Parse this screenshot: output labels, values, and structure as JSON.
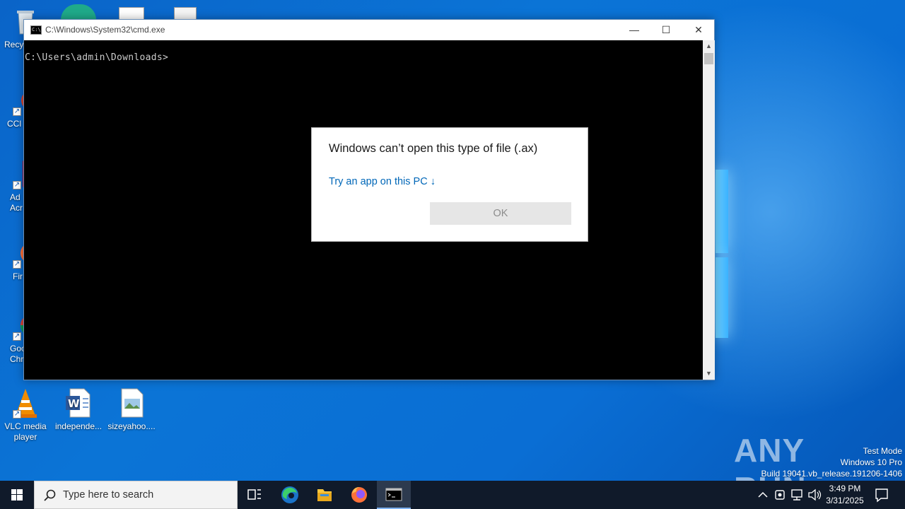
{
  "desktop": {
    "icons": [
      {
        "label": "Recy"
      },
      {
        "label": "CCl"
      },
      {
        "label": "Ad Acr"
      },
      {
        "label": "Fir"
      },
      {
        "label": "Goo Chr"
      },
      {
        "label": "VLC media player"
      },
      {
        "label": "independe..."
      },
      {
        "label": "sizeyahoo...."
      }
    ]
  },
  "cmd": {
    "title": "C:\\Windows\\System32\\cmd.exe",
    "prompt": "C:\\Users\\admin\\Downloads>",
    "minimize_glyph": "—",
    "maximize_glyph": "☐",
    "close_glyph": "✕"
  },
  "dialog": {
    "heading": "Windows can’t open this type of file (.ax)",
    "link": "Try an app on this PC ↓",
    "ok_label": "OK"
  },
  "watermark": {
    "brand": "ANY RUN",
    "line1": "Test Mode",
    "line2": "Windows 10 Pro",
    "line3": "Build 19041.vb_release.191206-1406"
  },
  "taskbar": {
    "search_placeholder": "Type here to search",
    "time": "3:49 PM",
    "date": "3/31/2025"
  },
  "colors": {
    "accent": "#0067b8",
    "desktop": "#0a6ed4",
    "taskbar": "#101a2a"
  }
}
